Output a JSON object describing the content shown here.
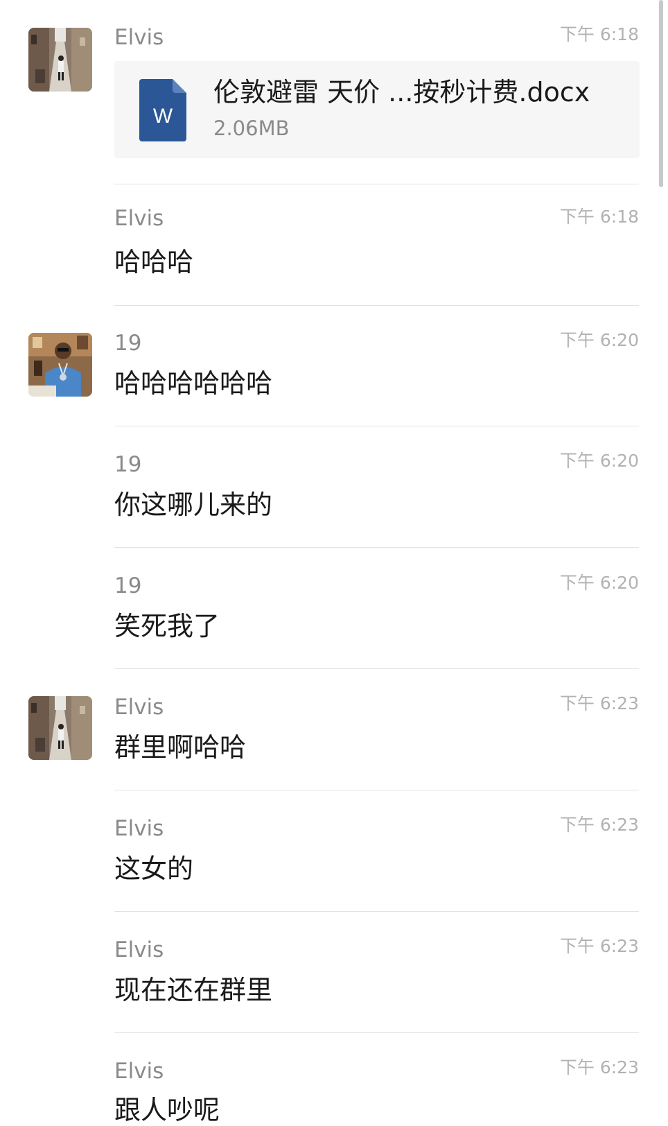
{
  "messages": [
    {
      "sender": "Elvis",
      "time": "下午 6:18",
      "type": "file",
      "file": {
        "name": "伦敦避雷 天价 ...按秒计费.docx",
        "size": "2.06MB",
        "icon_letter": "W",
        "icon": "word-document-icon"
      }
    },
    {
      "sender": "Elvis",
      "time": "下午 6:18",
      "text": "哈哈哈"
    },
    {
      "sender": "19",
      "time": "下午 6:20",
      "text": "哈哈哈哈哈哈"
    },
    {
      "sender": "19",
      "time": "下午 6:20",
      "text": "你这哪儿来的"
    },
    {
      "sender": "19",
      "time": "下午 6:20",
      "text": "笑死我了"
    },
    {
      "sender": "Elvis",
      "time": "下午 6:23",
      "text": "群里啊哈哈"
    },
    {
      "sender": "Elvis",
      "time": "下午 6:23",
      "text": "这女的"
    },
    {
      "sender": "Elvis",
      "time": "下午 6:23",
      "text": "现在还在群里"
    },
    {
      "sender": "Elvis",
      "time": "下午 6:23",
      "text": "跟人吵呢"
    }
  ],
  "colors": {
    "word_icon": "#2b5797",
    "file_card_bg": "#f6f6f6",
    "sender": "#8a8a8a",
    "time": "#b2b2b2"
  }
}
